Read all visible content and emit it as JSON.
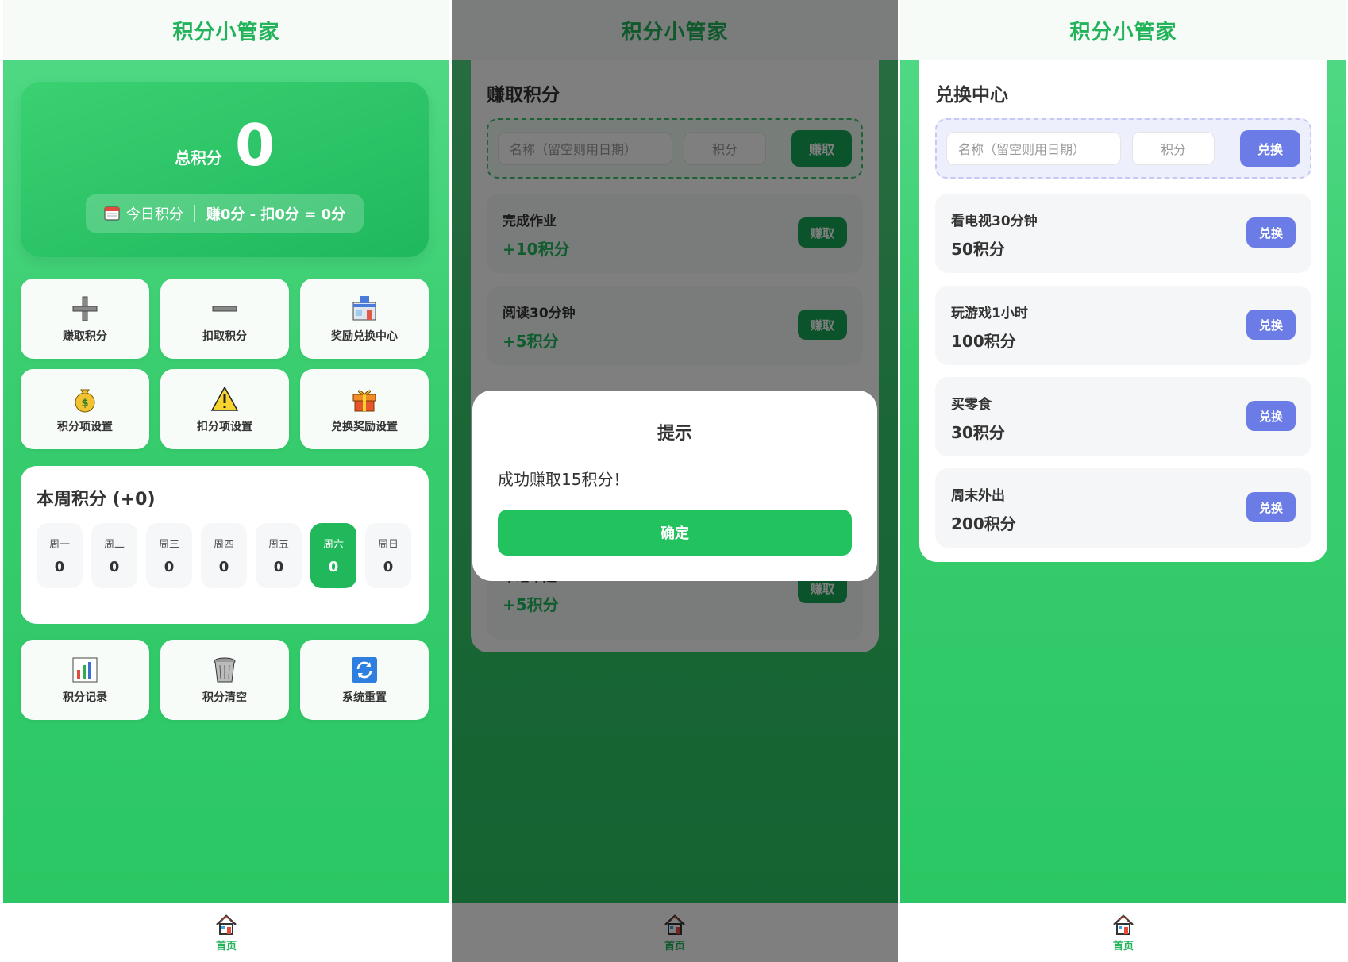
{
  "app_title": "积分小管家",
  "tabbar": {
    "home_label": "首页",
    "icon": "house-icon"
  },
  "home": {
    "total_label": "总积分",
    "total_value": "0",
    "today_label": "今日积分",
    "today_formula": "赚0分 - 扣0分 = 0分",
    "actions": [
      {
        "label": "赚取积分",
        "icon": "plus-icon"
      },
      {
        "label": "扣取积分",
        "icon": "minus-icon"
      },
      {
        "label": "奖励兑换中心",
        "icon": "store-icon"
      },
      {
        "label": "积分项设置",
        "icon": "money-bag-icon"
      },
      {
        "label": "扣分项设置",
        "icon": "warning-icon"
      },
      {
        "label": "兑换奖励设置",
        "icon": "gift-icon"
      }
    ],
    "week": {
      "title": "本周积分 (+0)",
      "days": [
        {
          "name": "周一",
          "value": "0"
        },
        {
          "name": "周二",
          "value": "0"
        },
        {
          "name": "周三",
          "value": "0"
        },
        {
          "name": "周四",
          "value": "0"
        },
        {
          "name": "周五",
          "value": "0"
        },
        {
          "name": "周六",
          "value": "0",
          "active": true
        },
        {
          "name": "周日",
          "value": "0"
        }
      ]
    },
    "tools": [
      {
        "label": "积分记录",
        "icon": "bar-chart-icon"
      },
      {
        "label": "积分清空",
        "icon": "trash-icon"
      },
      {
        "label": "系统重置",
        "icon": "refresh-icon"
      }
    ]
  },
  "earn": {
    "title": "赚取积分",
    "name_placeholder": "名称（留空则用日期）",
    "points_placeholder": "积分",
    "add_button": "赚取",
    "items": [
      {
        "name": "完成作业",
        "points": "+10积分",
        "button": "赚取"
      },
      {
        "name": "阅读30分钟",
        "points": "+5积分",
        "button": "赚取"
      },
      {
        "name": "早睡早起",
        "points": "+5积分",
        "button": "赚取"
      }
    ],
    "dialog": {
      "title": "提示",
      "message": "成功赚取15积分！",
      "confirm": "确定"
    }
  },
  "redeem": {
    "title": "兑换中心",
    "name_placeholder": "名称（留空则用日期）",
    "points_placeholder": "积分",
    "add_button": "兑换",
    "items": [
      {
        "name": "看电视30分钟",
        "points": "50积分",
        "button": "兑换"
      },
      {
        "name": "玩游戏1小时",
        "points": "100积分",
        "button": "兑换"
      },
      {
        "name": "买零食",
        "points": "30积分",
        "button": "兑换"
      },
      {
        "name": "周末外出",
        "points": "200积分",
        "button": "兑换"
      }
    ]
  },
  "colors": {
    "primary_green": "#22c25e",
    "redeem_blue": "#6b7ce6",
    "header_text": "#23b35a"
  }
}
